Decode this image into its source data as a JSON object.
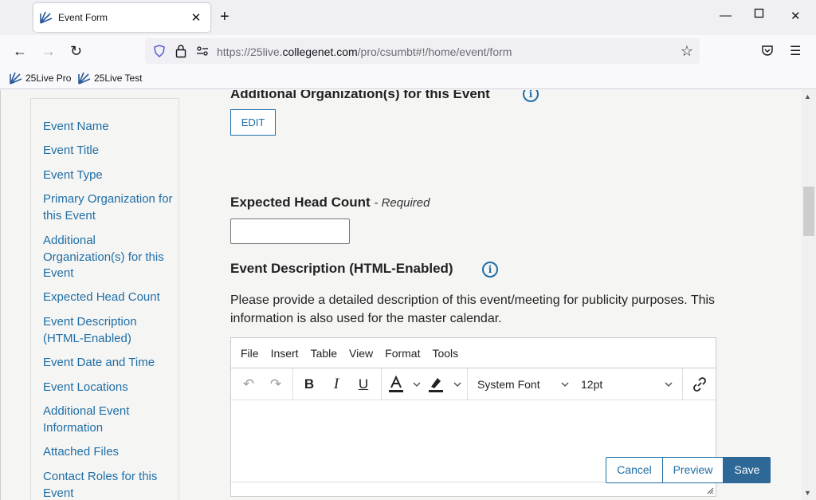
{
  "browser": {
    "tab_title": "Event Form",
    "url_prefix": "https://25live.",
    "url_domain": "collegenet.com",
    "url_path": "/pro/csumbt#!/home/event/form",
    "bookmarks": [
      "25Live Pro",
      "25Live Test"
    ]
  },
  "sidebar": {
    "items": [
      "Event Name",
      "Event Title",
      "Event Type",
      "Primary Organization for this Event",
      "Additional Organization(s) for this Event",
      "Expected Head Count",
      "Event Description (HTML-Enabled)",
      "Event Date and Time",
      "Event Locations",
      "Additional Event Information",
      "Attached Files",
      "Contact Roles for this Event"
    ]
  },
  "form": {
    "additional_orgs_title": "Additional Organization(s) for this Event",
    "edit_label": "EDIT",
    "head_count_title": "Expected Head Count",
    "head_count_required": "- Required",
    "head_count_value": "",
    "description_title": "Event Description (HTML-Enabled)",
    "description_help": "Please provide a detailed description of this event/meeting for publicity purposes. This information is also used for the master calendar."
  },
  "editor": {
    "menu": [
      "File",
      "Insert",
      "Table",
      "View",
      "Format",
      "Tools"
    ],
    "font_family": "System Font",
    "font_size": "12pt"
  },
  "actions": {
    "cancel": "Cancel",
    "preview": "Preview",
    "save": "Save"
  },
  "colors": {
    "link": "#1f6ea5",
    "save_bg": "#2d6896"
  }
}
